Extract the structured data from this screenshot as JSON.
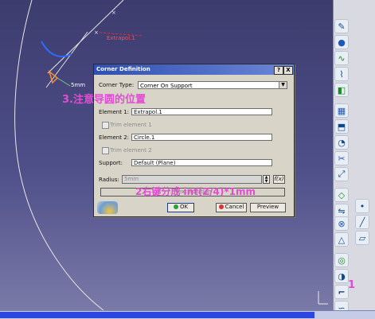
{
  "annotations": {
    "note3": "3.注意导圆的位置",
    "note2": "2右键分成 int(Z/4)*1mm",
    "note1": "1"
  },
  "viewport": {
    "labels": {
      "extrapol": "Extrapol.1",
      "point": "5mm"
    }
  },
  "dialog": {
    "title": "Corner Definition",
    "help_btn": "?",
    "close_btn": "X",
    "corner_type_label": "Corner Type:",
    "corner_type_value": "Corner On Support",
    "element1_label": "Element 1:",
    "element1_value": "Extrapol.1",
    "trim1_label": "Trim element 1",
    "element2_label": "Element 2:",
    "element2_value": "Circle.1",
    "trim2_label": "Trim element 2",
    "support_label": "Support:",
    "support_value": "Default (Plane)",
    "radius_label": "Radius:",
    "radius_value": "5mm",
    "formula_btn": "f(x)",
    "next_solution": "Next Solution",
    "ok": "OK",
    "cancel": "Cancel",
    "preview": "Preview"
  },
  "colors": {
    "annotation": "#e24bd3",
    "title_bar": "#2f4fb2",
    "viewport_bg": "#4a4a85"
  }
}
